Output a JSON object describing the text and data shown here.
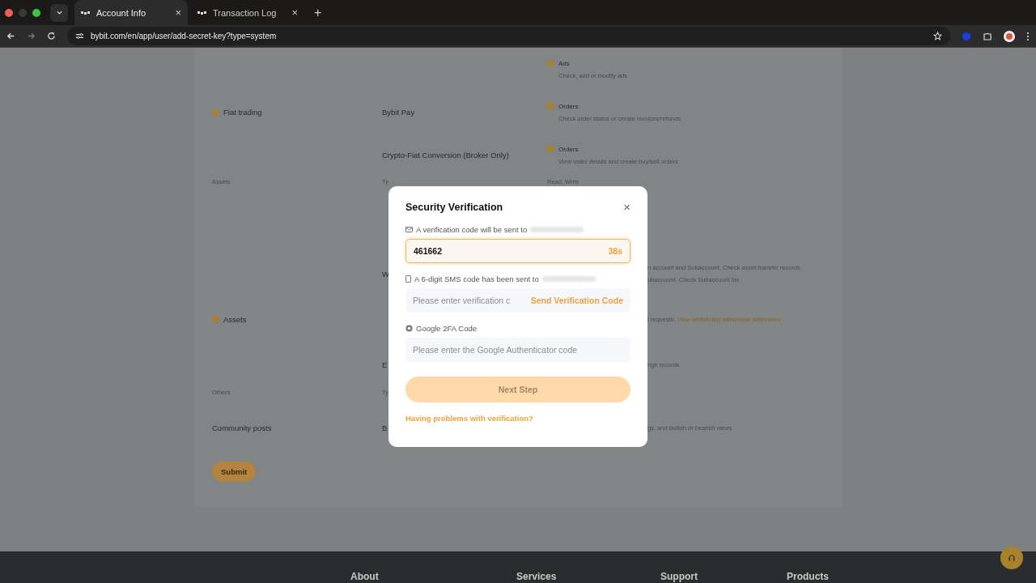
{
  "browser": {
    "tabs": [
      {
        "title": "Account Info",
        "close": "×",
        "selected": true
      },
      {
        "title": "Transaction Log",
        "close": "×",
        "selected": false
      }
    ],
    "new_tab": "+",
    "url": "bybit.com/en/app/user/add-secret-key?type=system"
  },
  "permissions": {
    "sections": [
      {
        "kind": "group",
        "name": "Fiat trading",
        "checked": true,
        "rows": [
          {
            "permission": "Ads",
            "checked": true,
            "description": "Check, add or modify ads"
          },
          {
            "product": "Bybit Pay",
            "permission": "Orders",
            "checked": true,
            "description": "Check order status or create invoices/refunds"
          },
          {
            "product": "Crypto-Fiat Conversion (Broker Only)",
            "permission": "Orders",
            "checked": true,
            "description": "View order details and create buy/sell orders"
          }
        ]
      },
      {
        "kind": "header",
        "column_1": "Assets",
        "column_2": "Ty",
        "column_3": "Read, Write"
      },
      {
        "kind": "group",
        "name": "Assets",
        "checked": true,
        "rows": [
          {
            "kind": "partial",
            "product": "W",
            "description": "n account and Subaccount. Check asset transfer records",
            "description_2": "ubaccount. Check Subaccount list"
          },
          {
            "kind": "partial",
            "description": "l requests.",
            "link": "View whitelisted withdrawal addresses"
          },
          {
            "kind": "partial",
            "product": "E",
            "description": "nge records"
          }
        ]
      },
      {
        "kind": "header",
        "column_1": "Others",
        "column_2": "Ty"
      },
      {
        "kind": "group",
        "name": "Community posts",
        "rows": [
          {
            "kind": "partial",
            "product": "B",
            "description": "gs, and bullish or bearish views"
          }
        ]
      }
    ],
    "submit": "Submit"
  },
  "modal": {
    "title": "Security Verification",
    "close": "×",
    "email_label": "A verification code will be sent to",
    "email_code": "461662",
    "countdown": "38s",
    "sms_label": "A 6-digit SMS code has been sent to",
    "sms_placeholder": "Please enter verification c",
    "send_code": "Send Verification Code",
    "google_label": "Google 2FA Code",
    "google_placeholder": "Please enter the Google Authenticator code",
    "next_step": "Next Step",
    "next_disabled": true,
    "help_link": "Having problems with verification?"
  },
  "footer": {
    "columns": [
      "About",
      "Services",
      "Support",
      "Products"
    ]
  }
}
